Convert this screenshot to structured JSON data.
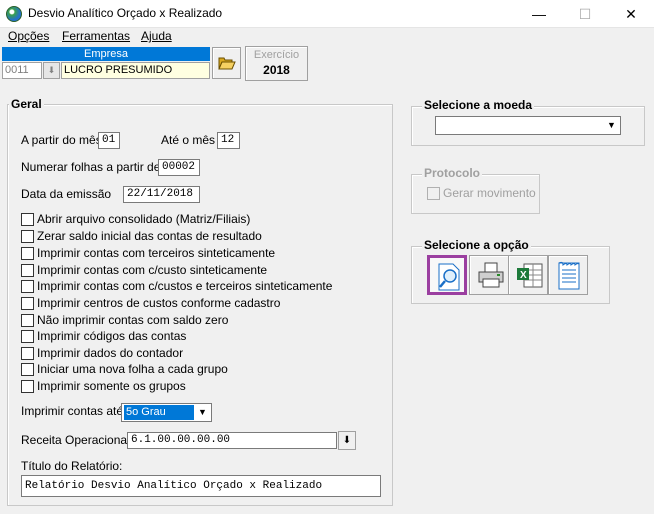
{
  "window": {
    "title": "Desvio Analítico Orçado x Realizado",
    "minimize_glyph": "—",
    "maximize_glyph": "☐",
    "close_glyph": "✕"
  },
  "menu": [
    {
      "label": "Opções"
    },
    {
      "label": "Ferramentas"
    },
    {
      "label": "Ajuda"
    }
  ],
  "empresa": {
    "header": "Empresa",
    "code": "0011",
    "name": "LUCRO PRESUMIDO"
  },
  "exercicio": {
    "label": "Exercício",
    "value": "2018"
  },
  "geral": {
    "title": "Geral",
    "from_month_label": "A partir do mês",
    "from_month_value": "01",
    "to_month_label": "Até o mês",
    "to_month_value": "12",
    "number_pages_label": "Numerar folhas a partir de",
    "number_pages_value": "00002",
    "emission_date_label": "Data da emissão",
    "emission_date_value": "22/11/2018",
    "checkboxes": [
      {
        "label": "Abrir arquivo consolidado (Matriz/Filiais)",
        "checked": false
      },
      {
        "label": "Zerar saldo inicial das contas de resultado",
        "checked": false
      },
      {
        "label": "Imprimir contas com terceiros sinteticamente",
        "checked": false
      },
      {
        "label": "Imprimir contas com c/custo sinteticamente",
        "checked": false
      },
      {
        "label": "Imprimir contas com c/custos e terceiros sinteticamente",
        "checked": false
      },
      {
        "label": "Imprimir centros de custos conforme cadastro",
        "checked": false
      },
      {
        "label": "Não imprimir contas com saldo zero",
        "checked": false
      },
      {
        "label": "Imprimir códigos das contas",
        "checked": false
      },
      {
        "label": "Imprimir dados do contador",
        "checked": false
      },
      {
        "label": "Iniciar uma nova folha a cada grupo",
        "checked": false
      },
      {
        "label": "Imprimir somente os grupos",
        "checked": false
      }
    ],
    "print_until_label": "Imprimir contas até:",
    "print_until_value": "5o Grau",
    "receita_label": "Receita Operacional:",
    "receita_value": "6.1.00.00.00.00",
    "report_title_label": "Título do Relatório:",
    "report_title_value": "Relatório Desvio Analítico Orçado x Realizado"
  },
  "moeda": {
    "title": "Selecione a moeda",
    "value": ""
  },
  "protocolo": {
    "title": "Protocolo",
    "checkbox_label": "Gerar movimento"
  },
  "opcao": {
    "title": "Selecione a opção",
    "buttons": [
      "preview-icon",
      "printer-icon",
      "excel-export-icon",
      "text-file-icon"
    ],
    "selected_index": 0,
    "selected_color": "#9b3fa0"
  }
}
